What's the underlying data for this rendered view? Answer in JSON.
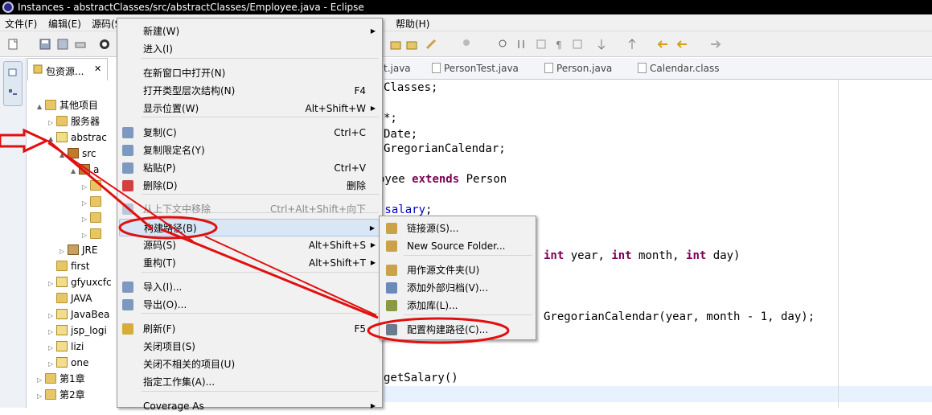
{
  "window": {
    "title": "Instances - abstractClasses/src/abstractClasses/Employee.java - Eclipse"
  },
  "menubar": {
    "items": [
      "文件(F)",
      "编辑(E)",
      "源码(S)",
      "帮助(H)"
    ]
  },
  "explorer": {
    "tab_label": "包资源...",
    "rows": [
      {
        "label": "其他项目",
        "toggle": "▲",
        "icon": "folder"
      },
      {
        "label": "服务器",
        "toggle": "▷",
        "icon": "folder"
      },
      {
        "label": "abstrac",
        "toggle": "▲",
        "icon": "proj"
      },
      {
        "label": "src",
        "toggle": "▲",
        "icon": "pkg"
      },
      {
        "label": "a",
        "toggle": "▲",
        "icon": "pkg"
      },
      {
        "label": "",
        "toggle": "▷",
        "icon": "file"
      },
      {
        "label": "",
        "toggle": "▷",
        "icon": "file"
      },
      {
        "label": "",
        "toggle": "▷",
        "icon": "file"
      },
      {
        "label": "",
        "toggle": "▷",
        "icon": "file"
      },
      {
        "label": "JRE",
        "toggle": "▷",
        "icon": "jar"
      },
      {
        "label": "first",
        "toggle": "",
        "icon": "folder"
      },
      {
        "label": "gfyuxcfc",
        "toggle": "▷",
        "icon": "proj"
      },
      {
        "label": "JAVA",
        "toggle": "",
        "icon": "folder"
      },
      {
        "label": "JavaBea",
        "toggle": "▷",
        "icon": "proj"
      },
      {
        "label": "jsp_logi",
        "toggle": "▷",
        "icon": "proj"
      },
      {
        "label": "lizi",
        "toggle": "▷",
        "icon": "proj"
      },
      {
        "label": "one",
        "toggle": "▷",
        "icon": "proj"
      },
      {
        "label": "第1章",
        "toggle": "▷",
        "icon": "folder"
      },
      {
        "label": "第2章",
        "toggle": "▷",
        "icon": "folder"
      }
    ]
  },
  "editor": {
    "tabs": [
      "t.java",
      "PersonTest.java",
      "Person.java",
      "Calendar.class"
    ],
    "code_lines": [
      {
        "parts": [
          {
            "t": "Classes;",
            "c": ""
          }
        ]
      },
      {
        "parts": [
          {
            "t": "*;",
            "c": ""
          }
        ]
      },
      {
        "parts": [
          {
            "t": "Date;",
            "c": ""
          }
        ]
      },
      {
        "parts": [
          {
            "t": "GregorianCalendar;",
            "c": ""
          }
        ]
      },
      {
        "parts": [
          {
            "t": "oyee ",
            "c": ""
          },
          {
            "t": "extends",
            "c": "kw"
          },
          {
            "t": " Person",
            "c": ""
          }
        ]
      },
      {
        "parts": [
          {
            "t": " salary",
            "c": "fld"
          },
          {
            "t": ";",
            "c": ""
          }
        ]
      },
      {
        "parts": [
          {
            "t": "int",
            "c": "kw"
          },
          {
            "t": " year, ",
            "c": ""
          },
          {
            "t": "int",
            "c": "kw"
          },
          {
            "t": " month, ",
            "c": ""
          },
          {
            "t": "int",
            "c": "kw"
          },
          {
            "t": " day)",
            "c": ""
          }
        ]
      },
      {
        "parts": [
          {
            "t": "GregorianCalendar(year, month - 1, day);",
            "c": ""
          }
        ]
      },
      {
        "parts": [
          {
            "t": "getSalary()",
            "c": ""
          }
        ]
      }
    ]
  },
  "context_menu": {
    "items": [
      {
        "label": "新建(W)",
        "accel": "",
        "submenu": true
      },
      {
        "label": "进入(I)",
        "accel": "",
        "submenu": false
      },
      {
        "label": "在新窗口中打开(N)",
        "accel": "",
        "submenu": false
      },
      {
        "label": "打开类型层次结构(N)",
        "accel": "F4",
        "submenu": false
      },
      {
        "label": "显示位置(W)",
        "accel": "Alt+Shift+W",
        "submenu": true
      },
      {
        "label": "复制(C)",
        "accel": "Ctrl+C",
        "submenu": false
      },
      {
        "label": "复制限定名(Y)",
        "accel": "",
        "submenu": false
      },
      {
        "label": "粘贴(P)",
        "accel": "Ctrl+V",
        "submenu": false
      },
      {
        "label": "删除(D)",
        "accel": "删除",
        "submenu": false
      },
      {
        "label": "从上下文中移除",
        "accel": "Ctrl+Alt+Shift+向下",
        "submenu": false,
        "disabled": true
      },
      {
        "label": "构建路径(B)",
        "accel": "",
        "submenu": true,
        "hot": true
      },
      {
        "label": "源码(S)",
        "accel": "Alt+Shift+S",
        "submenu": true
      },
      {
        "label": "重构(T)",
        "accel": "Alt+Shift+T",
        "submenu": true
      },
      {
        "label": "导入(I)...",
        "accel": "",
        "submenu": false
      },
      {
        "label": "导出(O)...",
        "accel": "",
        "submenu": false
      },
      {
        "label": "刷新(F)",
        "accel": "F5",
        "submenu": false
      },
      {
        "label": "关闭项目(S)",
        "accel": "",
        "submenu": false
      },
      {
        "label": "关闭不相关的项目(U)",
        "accel": "",
        "submenu": false
      },
      {
        "label": "指定工作集(A)...",
        "accel": "",
        "submenu": false
      },
      {
        "label": "Coverage As",
        "accel": "",
        "submenu": true
      }
    ]
  },
  "build_path_submenu": {
    "items": [
      "链接源(S)...",
      "New Source Folder...",
      "用作源文件夹(U)",
      "添加外部归档(V)...",
      "添加库(L)...",
      "配置构建路径(C)..."
    ]
  },
  "annotations": {
    "color": "#e01010"
  }
}
